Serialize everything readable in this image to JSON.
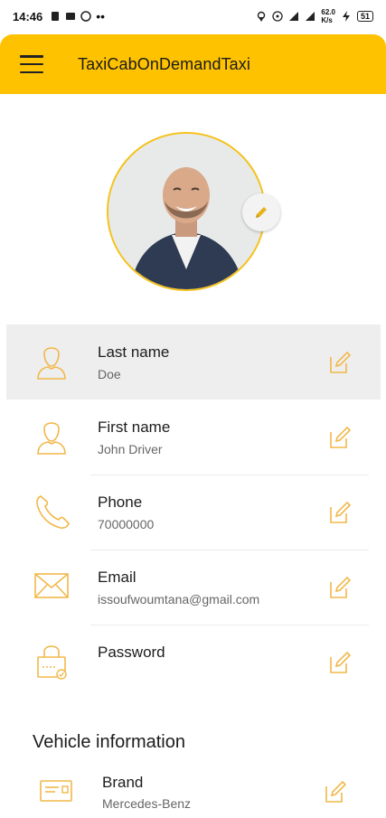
{
  "status_bar": {
    "time": "14:46",
    "network_speed_value": "62.0",
    "network_speed_unit": "K/s",
    "battery": "51"
  },
  "app_bar": {
    "title": "TaxiCabOnDemandTaxi",
    "menu_icon": "hamburger-menu-icon"
  },
  "profile": {
    "edit_photo_icon": "pencil-icon"
  },
  "fields": [
    {
      "label": "Last name",
      "value": "Doe",
      "icon": "user-icon"
    },
    {
      "label": "First name",
      "value": "John Driver",
      "icon": "user-icon"
    },
    {
      "label": "Phone",
      "value": "70000000",
      "icon": "phone-icon"
    },
    {
      "label": "Email",
      "value": "issoufwoumtana@gmail.com",
      "icon": "envelope-icon"
    },
    {
      "label": "Password",
      "value": "",
      "icon": "lock-icon"
    }
  ],
  "vehicle": {
    "section_title": "Vehicle information",
    "brand": {
      "label": "Brand",
      "value": "Mercedes-Benz",
      "icon": "id-card-icon"
    }
  },
  "colors": {
    "accent": "#FEC200",
    "icon_outline": "#F1B84A",
    "active_row": "#eeeeee"
  }
}
